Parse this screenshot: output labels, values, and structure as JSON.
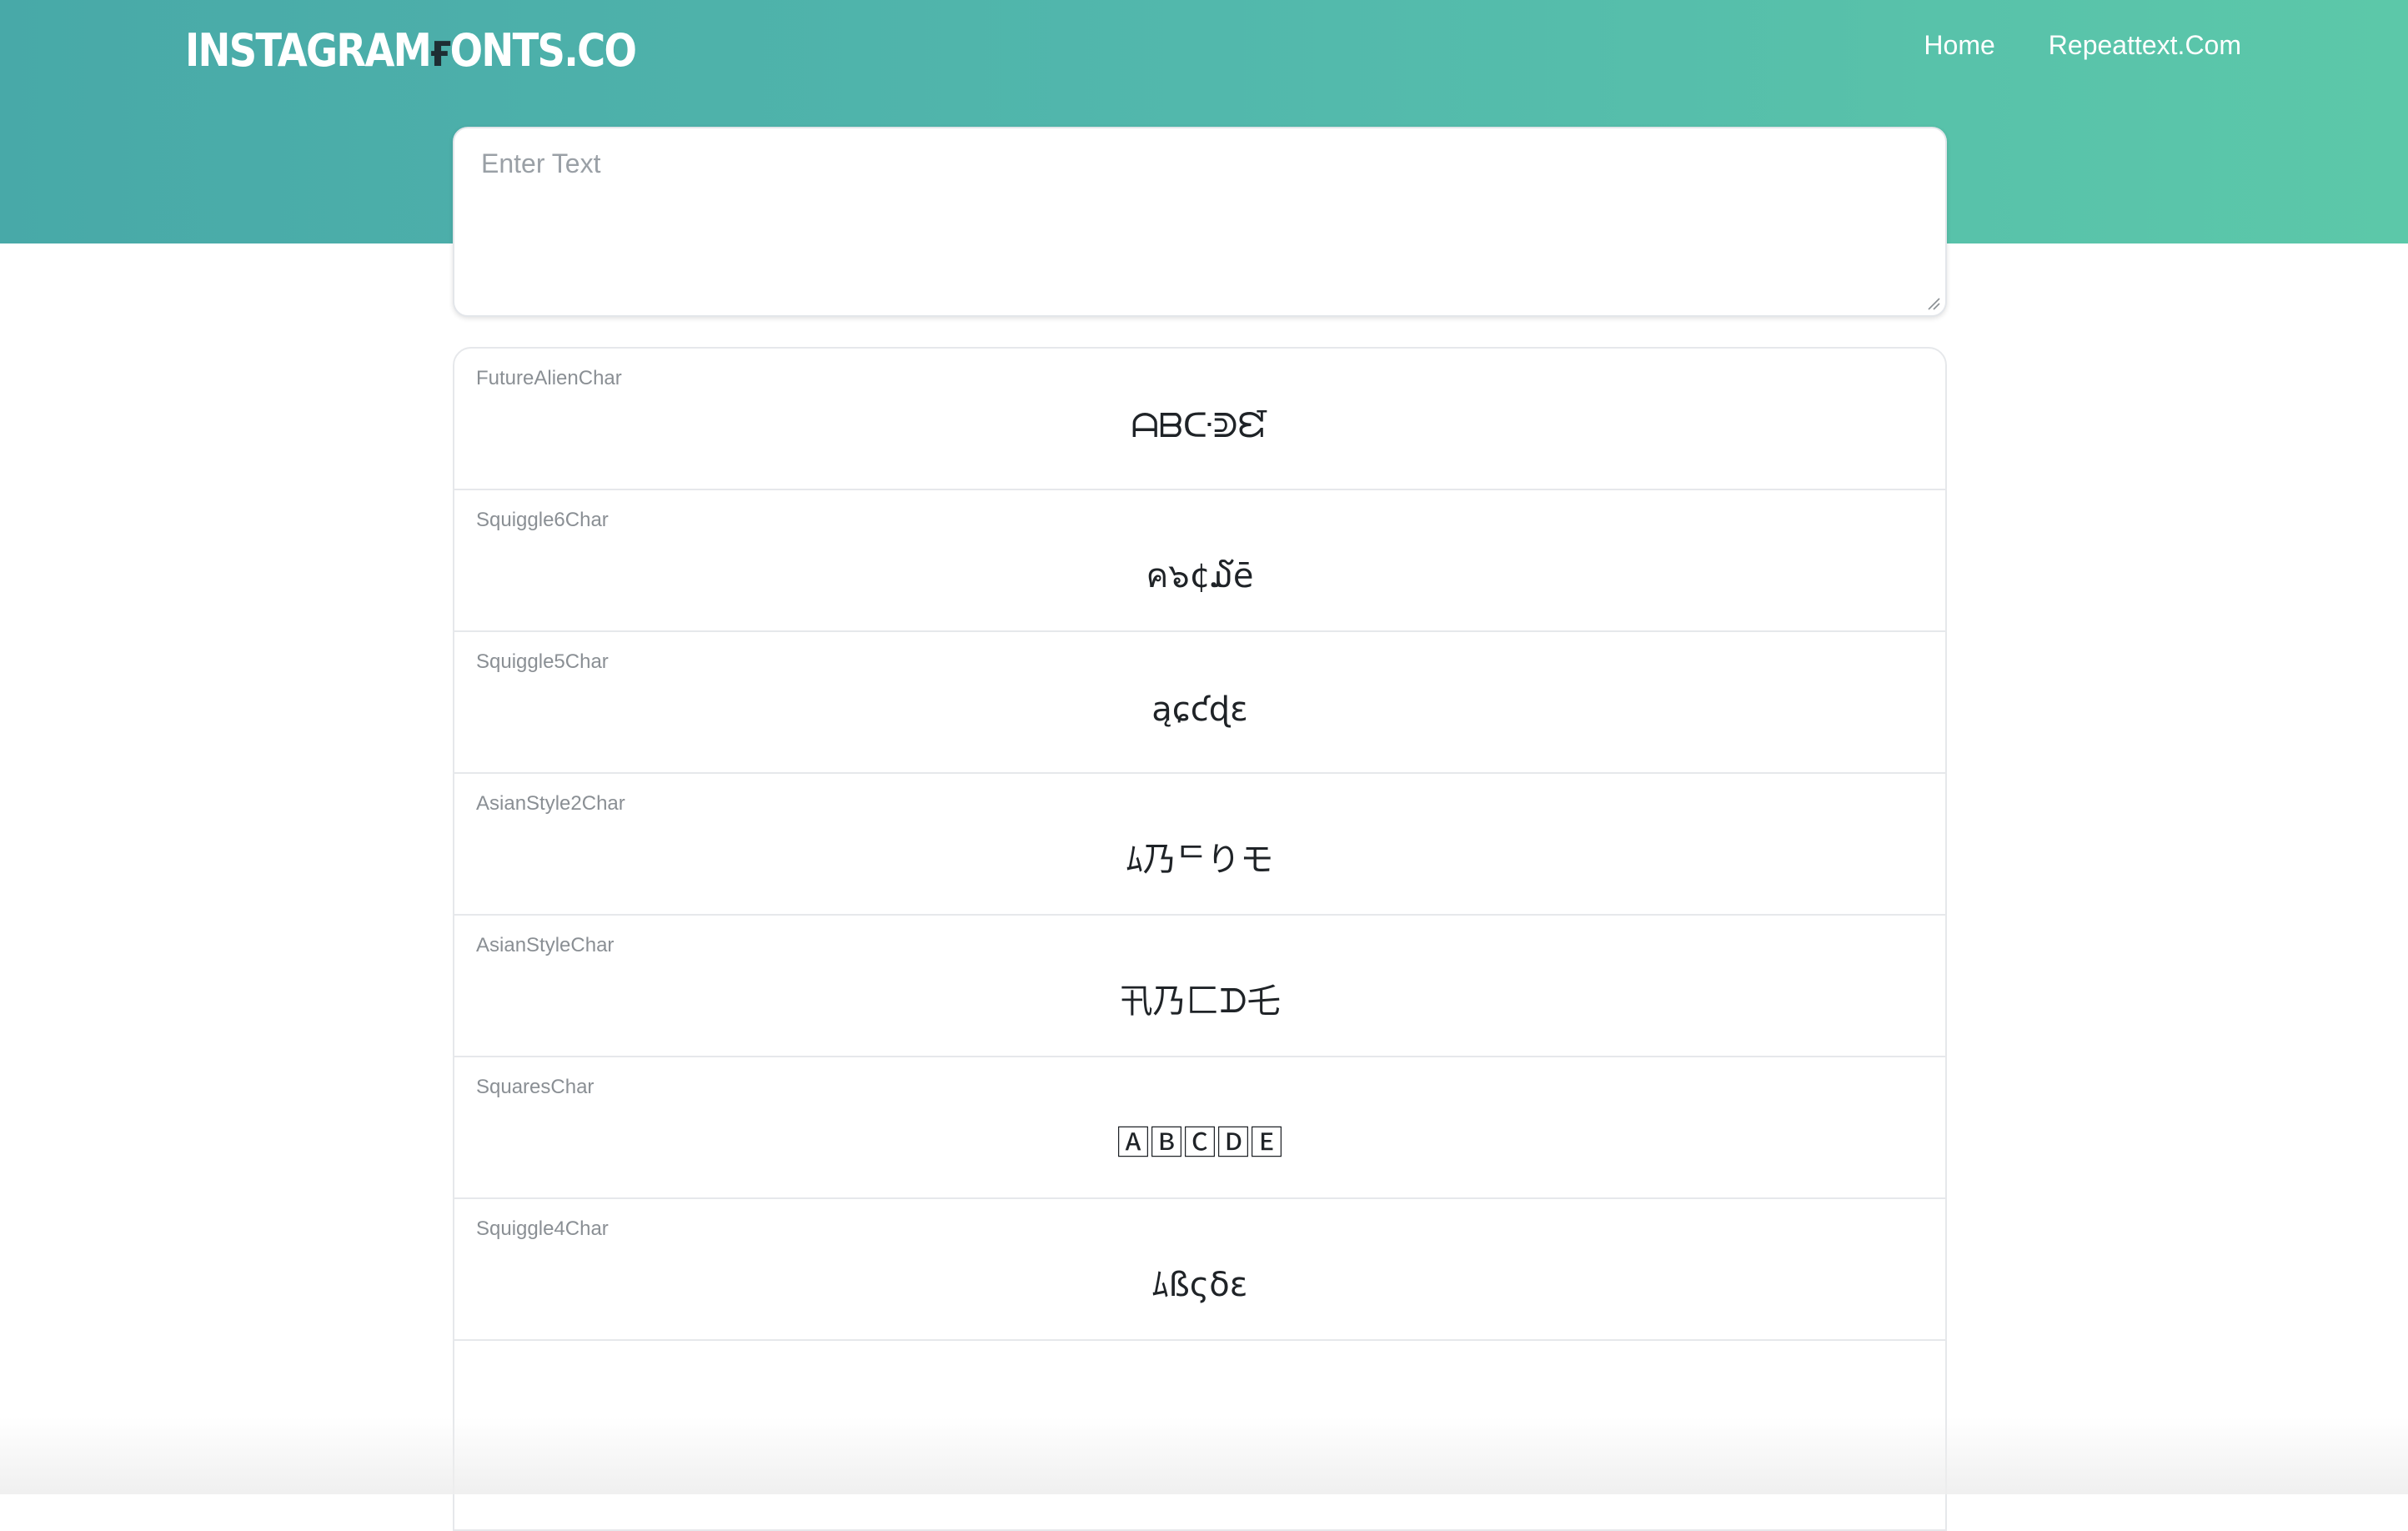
{
  "header": {
    "logo_left": "INSTAGRAM",
    "logo_accent": "ғ",
    "logo_right": "ONTS.CO",
    "nav": [
      "Home",
      "Repeattext.Com"
    ]
  },
  "input": {
    "placeholder": "Enter Text",
    "value": ""
  },
  "styles": [
    {
      "name": "FutureAlienChar",
      "sample": "ᗩᗷᑢᕲᘿ"
    },
    {
      "name": "Squiggle6Char",
      "sample": "ค๖¢໓ē"
    },
    {
      "name": "Squiggle5Char",
      "sample": "ąɕƈɖɛ"
    },
    {
      "name": "AsianStyle2Char",
      "sample": "ﾑ乃ᄃりモ"
    },
    {
      "name": "AsianStyleChar",
      "sample": "卂乃匚ᗪ乇"
    },
    {
      "name": "SquaresChar",
      "sample": "🄰🄱🄲🄳🄴"
    },
    {
      "name": "Squiggle4Char",
      "sample": "ﾑßςδε"
    }
  ]
}
